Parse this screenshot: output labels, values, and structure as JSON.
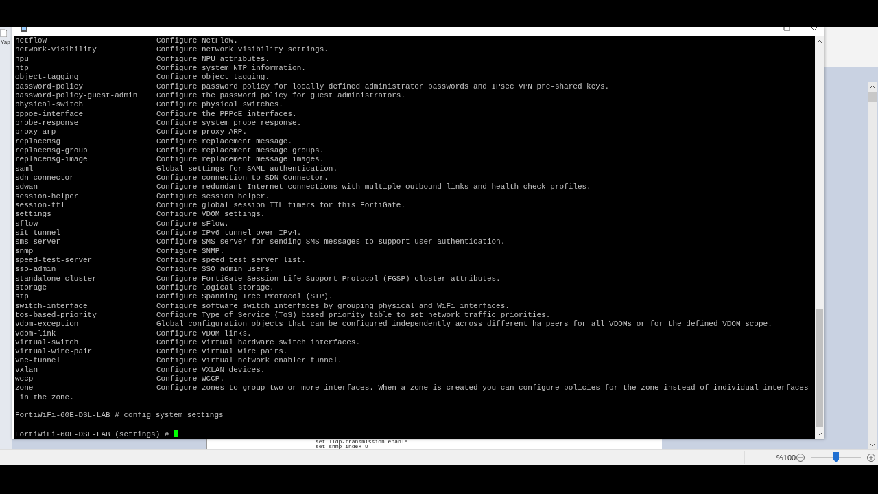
{
  "background_app": {
    "side_label": "Yap",
    "document_lines": [
      "set lldp-transmission enable",
      "set snmp-index 9"
    ],
    "zoom": {
      "reading": "%100",
      "level": 0.5
    }
  },
  "terminal": {
    "entries": [
      {
        "command": "netflow",
        "description": "Configure NetFlow."
      },
      {
        "command": "network-visibility",
        "description": "Configure network visibility settings."
      },
      {
        "command": "npu",
        "description": "Configure NPU attributes."
      },
      {
        "command": "ntp",
        "description": "Configure system NTP information."
      },
      {
        "command": "object-tagging",
        "description": "Configure object tagging."
      },
      {
        "command": "password-policy",
        "description": "Configure password policy for locally defined administrator passwords and IPsec VPN pre-shared keys."
      },
      {
        "command": "password-policy-guest-admin",
        "description": "Configure the password policy for guest administrators."
      },
      {
        "command": "physical-switch",
        "description": "Configure physical switches."
      },
      {
        "command": "pppoe-interface",
        "description": "Configure the PPPoE interfaces."
      },
      {
        "command": "probe-response",
        "description": "Configure system probe response."
      },
      {
        "command": "proxy-arp",
        "description": "Configure proxy-ARP."
      },
      {
        "command": "replacemsg",
        "description": "Configure replacement message."
      },
      {
        "command": "replacemsg-group",
        "description": "Configure replacement message groups."
      },
      {
        "command": "replacemsg-image",
        "description": "Configure replacement message images."
      },
      {
        "command": "saml",
        "description": "Global settings for SAML authentication."
      },
      {
        "command": "sdn-connector",
        "description": "Configure connection to SDN Connector."
      },
      {
        "command": "sdwan",
        "description": "Configure redundant Internet connections with multiple outbound links and health-check profiles."
      },
      {
        "command": "session-helper",
        "description": "Configure session helper."
      },
      {
        "command": "session-ttl",
        "description": "Configure global session TTL timers for this FortiGate."
      },
      {
        "command": "settings",
        "description": "Configure VDOM settings."
      },
      {
        "command": "sflow",
        "description": "Configure sFlow."
      },
      {
        "command": "sit-tunnel",
        "description": "Configure IPv6 tunnel over IPv4."
      },
      {
        "command": "sms-server",
        "description": "Configure SMS server for sending SMS messages to support user authentication."
      },
      {
        "command": "snmp",
        "description": "Configure SNMP."
      },
      {
        "command": "speed-test-server",
        "description": "Configure speed test server list."
      },
      {
        "command": "sso-admin",
        "description": "Configure SSO admin users."
      },
      {
        "command": "standalone-cluster",
        "description": "Configure FortiGate Session Life Support Protocol (FGSP) cluster attributes."
      },
      {
        "command": "storage",
        "description": "Configure logical storage."
      },
      {
        "command": "stp",
        "description": "Configure Spanning Tree Protocol (STP)."
      },
      {
        "command": "switch-interface",
        "description": "Configure software switch interfaces by grouping physical and WiFi interfaces."
      },
      {
        "command": "tos-based-priority",
        "description": "Configure Type of Service (ToS) based priority table to set network traffic priorities."
      },
      {
        "command": "vdom-exception",
        "description": "Global configuration objects that can be configured independently across different ha peers for all VDOMs or for the defined VDOM scope."
      },
      {
        "command": "vdom-link",
        "description": "Configure VDOM links."
      },
      {
        "command": "virtual-switch",
        "description": "Configure virtual hardware switch interfaces."
      },
      {
        "command": "virtual-wire-pair",
        "description": "Configure virtual wire pairs."
      },
      {
        "command": "vne-tunnel",
        "description": "Configure virtual network enabler tunnel."
      },
      {
        "command": "vxlan",
        "description": "Configure VXLAN devices."
      },
      {
        "command": "wccp",
        "description": "Configure WCCP."
      },
      {
        "command": "zone",
        "description": "Configure zones to group two or more interfaces. When a zone is created you can configure policies for the zone instead of individual interfaces",
        "continuation": "in the zone."
      }
    ],
    "history": [
      {
        "prompt": "FortiWiFi-60E-DSL-LAB #",
        "input": "config system settings"
      }
    ],
    "prompt": "FortiWiFi-60E-DSL-LAB (settings) #",
    "cursor_visible": true
  }
}
